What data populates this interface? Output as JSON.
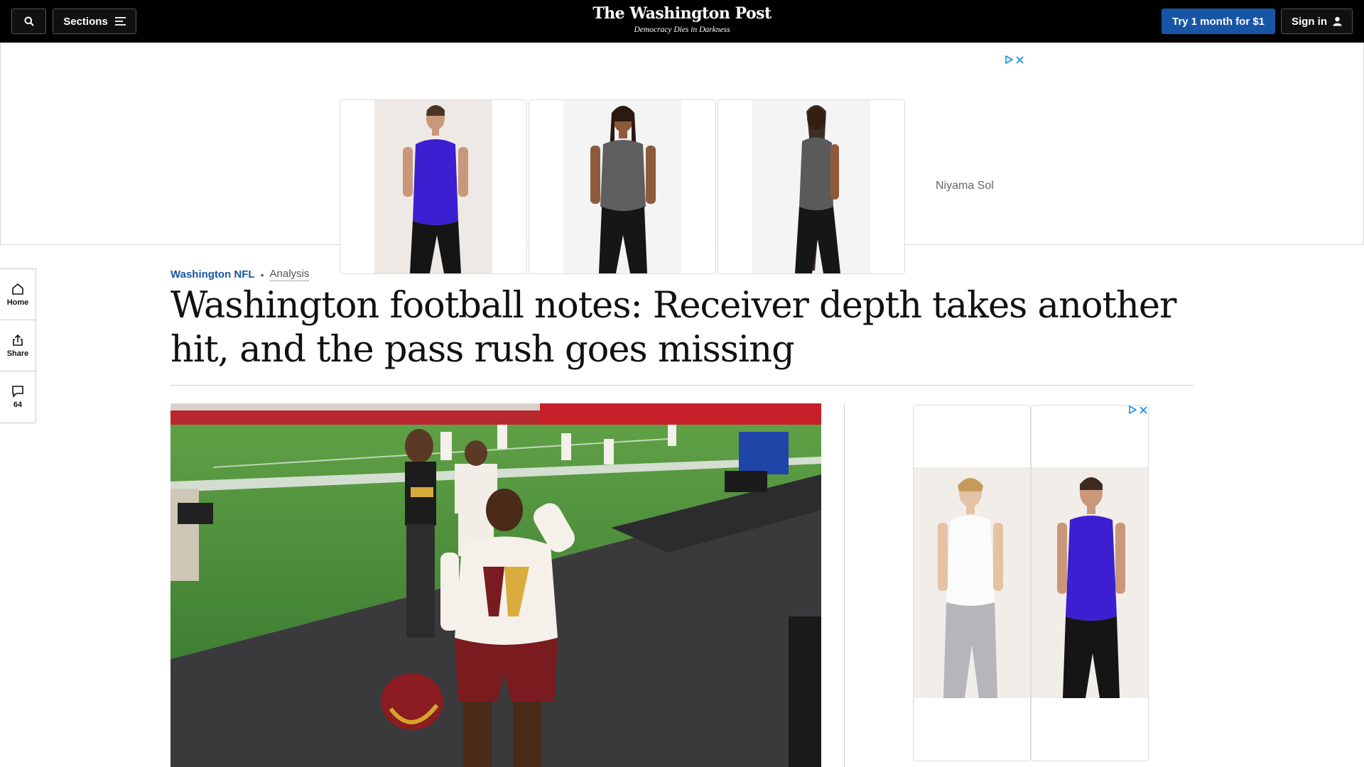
{
  "header": {
    "sections_label": "Sections",
    "logo": "The Washington Post",
    "tagline": "Democracy Dies in Darkness",
    "subscribe_label": "Try 1 month for $1",
    "signin_label": "Sign in"
  },
  "top_ad": {
    "brand": "Niyama Sol"
  },
  "left_rail": {
    "home_label": "Home",
    "share_label": "Share",
    "comments_count": "64"
  },
  "article": {
    "section": "Washington NFL",
    "label": "Analysis",
    "headline": "Washington football notes: Receiver depth takes another hit, and the pass rush goes missing"
  },
  "colors": {
    "accent": "#1955a5",
    "topbar": "#000000",
    "adchoices": "#1a8fe3"
  },
  "icons": [
    "search-icon",
    "menu-icon",
    "person-icon",
    "adchoices-icon",
    "close-icon",
    "home-icon",
    "share-icon",
    "comment-icon"
  ]
}
